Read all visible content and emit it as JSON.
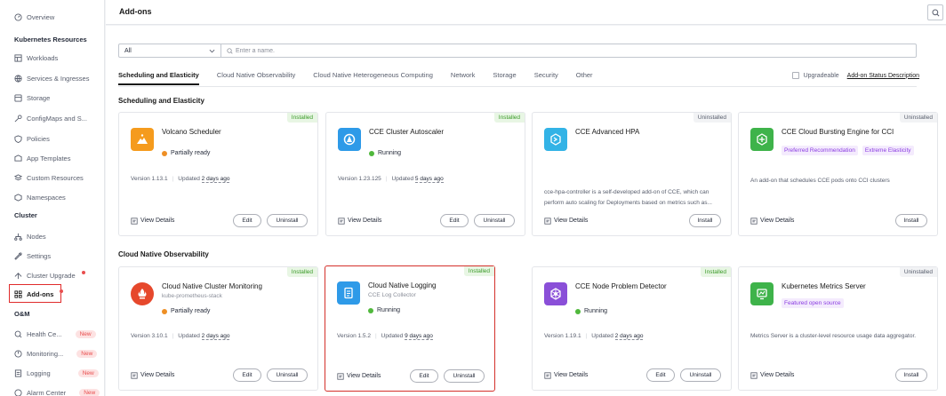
{
  "sidebar": {
    "overview": "Overview",
    "section_k8s": "Kubernetes Resources",
    "workloads": "Workloads",
    "services": "Services & Ingresses",
    "storage": "Storage",
    "configmaps": "ConfigMaps and S...",
    "policies": "Policies",
    "app_templates": "App Templates",
    "custom_resources": "Custom Resources",
    "namespaces": "Namespaces",
    "section_cluster": "Cluster",
    "nodes": "Nodes",
    "settings": "Settings",
    "cluster_upgrade": "Cluster Upgrade",
    "addons": "Add-ons",
    "section_om": "O&M",
    "health": "Health Ce...",
    "monitoring": "Monitoring...",
    "logging": "Logging",
    "alarm": "Alarm Center",
    "new_badge": "New"
  },
  "header": {
    "title": "Add-ons"
  },
  "filter": {
    "select_value": "All",
    "search_placeholder": "Enter a name."
  },
  "tabs": [
    "Scheduling and Elasticity",
    "Cloud Native Observability",
    "Cloud Native Heterogeneous Computing",
    "Network",
    "Storage",
    "Security",
    "Other"
  ],
  "upgradeable_label": "Upgradeable",
  "status_description_link": "Add-on Status Description",
  "groups": {
    "scheduling": "Scheduling and Elasticity",
    "observability": "Cloud Native Observability"
  },
  "labels": {
    "view_details": "View Details",
    "edit": "Edit",
    "uninstall": "Uninstall",
    "install": "Install",
    "version_prefix": "Version",
    "updated_prefix": "Updated"
  },
  "cards": {
    "volcano": {
      "name": "Volcano Scheduler",
      "status": "Installed",
      "state": "Partially ready",
      "version": "1.13.1",
      "updated": "2 days ago"
    },
    "autoscaler": {
      "name": "CCE Cluster Autoscaler",
      "status": "Installed",
      "state": "Running",
      "version": "1.23.125",
      "updated": "5 days ago"
    },
    "hpa": {
      "name": "CCE Advanced HPA",
      "status": "Uninstalled",
      "desc": "cce-hpa-controller is a self-developed add-on of CCE, which can perform auto scaling for Deployments based on metrics such as..."
    },
    "bursting": {
      "name": "CCE Cloud Bursting Engine for CCI",
      "status": "Uninstalled",
      "tag1": "Preferred Recommendation",
      "tag2": "Extreme Elasticity",
      "desc": "An add-on that schedules CCE pods onto CCI clusters"
    },
    "monitoring": {
      "name": "Cloud Native Cluster Monitoring",
      "sub": "kube-prometheus-stack",
      "status": "Installed",
      "state": "Partially ready",
      "version": "3.10.1",
      "updated": "2 days ago"
    },
    "logging": {
      "name": "Cloud Native Logging",
      "sub": "CCE Log Collector",
      "status": "Installed",
      "state": "Running",
      "version": "1.5.2",
      "updated": "9 days ago"
    },
    "npd": {
      "name": "CCE Node Problem Detector",
      "status": "Installed",
      "state": "Running",
      "version": "1.19.1",
      "updated": "2 days ago"
    },
    "metrics": {
      "name": "Kubernetes Metrics Server",
      "status": "Uninstalled",
      "tag1": "Featured open source",
      "desc": "Metrics Server is a cluster-level resource usage data aggregator."
    }
  }
}
